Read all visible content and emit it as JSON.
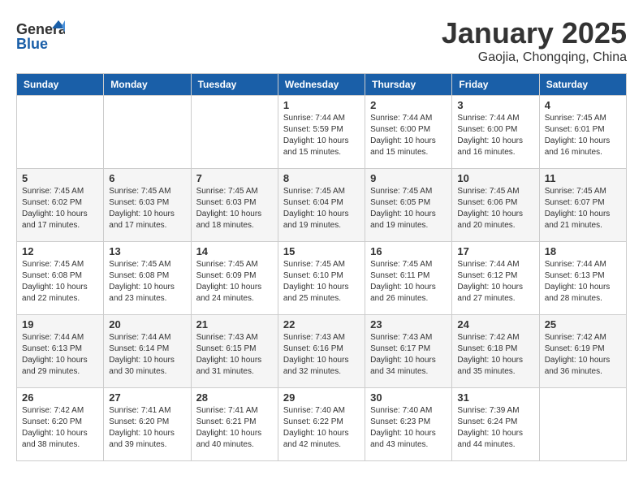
{
  "header": {
    "logo": {
      "text_general": "General",
      "text_blue": "Blue"
    },
    "title": "January 2025",
    "subtitle": "Gaojia, Chongqing, China"
  },
  "weekdays": [
    "Sunday",
    "Monday",
    "Tuesday",
    "Wednesday",
    "Thursday",
    "Friday",
    "Saturday"
  ],
  "weeks": [
    [
      {
        "day": null
      },
      {
        "day": null
      },
      {
        "day": null
      },
      {
        "day": 1,
        "info": "Sunrise: 7:44 AM\nSunset: 5:59 PM\nDaylight: 10 hours and 15 minutes."
      },
      {
        "day": 2,
        "info": "Sunrise: 7:44 AM\nSunset: 6:00 PM\nDaylight: 10 hours and 15 minutes."
      },
      {
        "day": 3,
        "info": "Sunrise: 7:44 AM\nSunset: 6:00 PM\nDaylight: 10 hours and 16 minutes."
      },
      {
        "day": 4,
        "info": "Sunrise: 7:45 AM\nSunset: 6:01 PM\nDaylight: 10 hours and 16 minutes."
      }
    ],
    [
      {
        "day": 5,
        "info": "Sunrise: 7:45 AM\nSunset: 6:02 PM\nDaylight: 10 hours and 17 minutes."
      },
      {
        "day": 6,
        "info": "Sunrise: 7:45 AM\nSunset: 6:03 PM\nDaylight: 10 hours and 17 minutes."
      },
      {
        "day": 7,
        "info": "Sunrise: 7:45 AM\nSunset: 6:03 PM\nDaylight: 10 hours and 18 minutes."
      },
      {
        "day": 8,
        "info": "Sunrise: 7:45 AM\nSunset: 6:04 PM\nDaylight: 10 hours and 19 minutes."
      },
      {
        "day": 9,
        "info": "Sunrise: 7:45 AM\nSunset: 6:05 PM\nDaylight: 10 hours and 19 minutes."
      },
      {
        "day": 10,
        "info": "Sunrise: 7:45 AM\nSunset: 6:06 PM\nDaylight: 10 hours and 20 minutes."
      },
      {
        "day": 11,
        "info": "Sunrise: 7:45 AM\nSunset: 6:07 PM\nDaylight: 10 hours and 21 minutes."
      }
    ],
    [
      {
        "day": 12,
        "info": "Sunrise: 7:45 AM\nSunset: 6:08 PM\nDaylight: 10 hours and 22 minutes."
      },
      {
        "day": 13,
        "info": "Sunrise: 7:45 AM\nSunset: 6:08 PM\nDaylight: 10 hours and 23 minutes."
      },
      {
        "day": 14,
        "info": "Sunrise: 7:45 AM\nSunset: 6:09 PM\nDaylight: 10 hours and 24 minutes."
      },
      {
        "day": 15,
        "info": "Sunrise: 7:45 AM\nSunset: 6:10 PM\nDaylight: 10 hours and 25 minutes."
      },
      {
        "day": 16,
        "info": "Sunrise: 7:45 AM\nSunset: 6:11 PM\nDaylight: 10 hours and 26 minutes."
      },
      {
        "day": 17,
        "info": "Sunrise: 7:44 AM\nSunset: 6:12 PM\nDaylight: 10 hours and 27 minutes."
      },
      {
        "day": 18,
        "info": "Sunrise: 7:44 AM\nSunset: 6:13 PM\nDaylight: 10 hours and 28 minutes."
      }
    ],
    [
      {
        "day": 19,
        "info": "Sunrise: 7:44 AM\nSunset: 6:13 PM\nDaylight: 10 hours and 29 minutes."
      },
      {
        "day": 20,
        "info": "Sunrise: 7:44 AM\nSunset: 6:14 PM\nDaylight: 10 hours and 30 minutes."
      },
      {
        "day": 21,
        "info": "Sunrise: 7:43 AM\nSunset: 6:15 PM\nDaylight: 10 hours and 31 minutes."
      },
      {
        "day": 22,
        "info": "Sunrise: 7:43 AM\nSunset: 6:16 PM\nDaylight: 10 hours and 32 minutes."
      },
      {
        "day": 23,
        "info": "Sunrise: 7:43 AM\nSunset: 6:17 PM\nDaylight: 10 hours and 34 minutes."
      },
      {
        "day": 24,
        "info": "Sunrise: 7:42 AM\nSunset: 6:18 PM\nDaylight: 10 hours and 35 minutes."
      },
      {
        "day": 25,
        "info": "Sunrise: 7:42 AM\nSunset: 6:19 PM\nDaylight: 10 hours and 36 minutes."
      }
    ],
    [
      {
        "day": 26,
        "info": "Sunrise: 7:42 AM\nSunset: 6:20 PM\nDaylight: 10 hours and 38 minutes."
      },
      {
        "day": 27,
        "info": "Sunrise: 7:41 AM\nSunset: 6:20 PM\nDaylight: 10 hours and 39 minutes."
      },
      {
        "day": 28,
        "info": "Sunrise: 7:41 AM\nSunset: 6:21 PM\nDaylight: 10 hours and 40 minutes."
      },
      {
        "day": 29,
        "info": "Sunrise: 7:40 AM\nSunset: 6:22 PM\nDaylight: 10 hours and 42 minutes."
      },
      {
        "day": 30,
        "info": "Sunrise: 7:40 AM\nSunset: 6:23 PM\nDaylight: 10 hours and 43 minutes."
      },
      {
        "day": 31,
        "info": "Sunrise: 7:39 AM\nSunset: 6:24 PM\nDaylight: 10 hours and 44 minutes."
      },
      {
        "day": null
      }
    ]
  ]
}
